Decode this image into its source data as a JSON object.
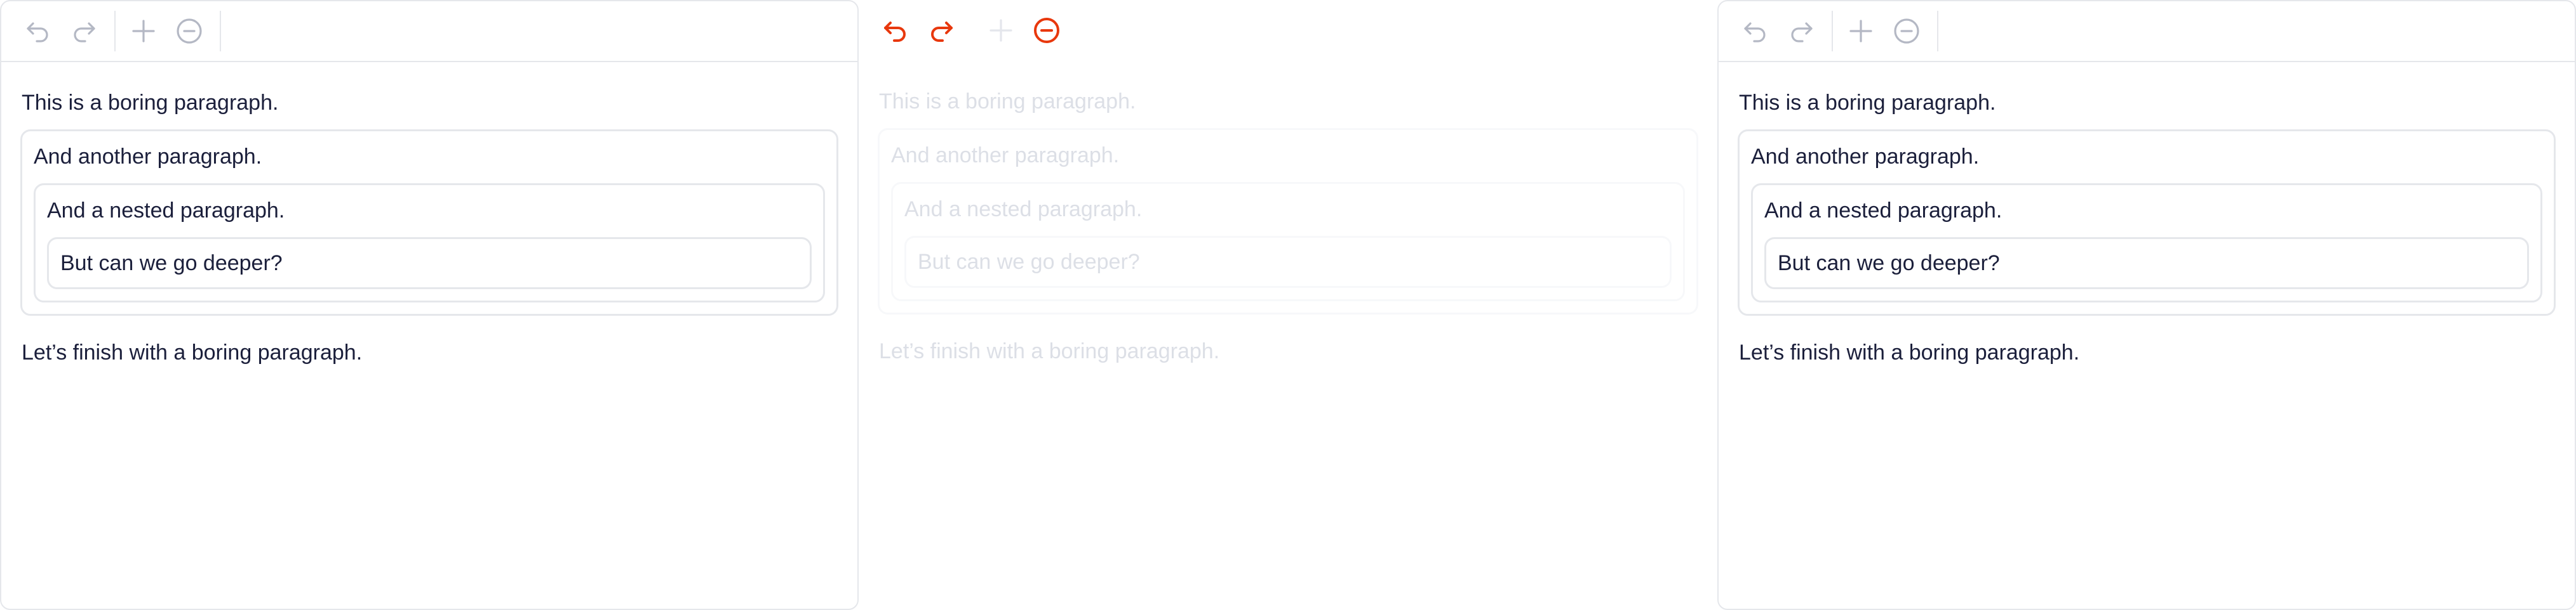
{
  "colors": {
    "text": "#1b1f3b",
    "border": "#e5e7eb",
    "icon_disabled": "#b4b8c4",
    "icon_enabled": "#e8380d",
    "faded_text": "#dcdfe6"
  },
  "icons": [
    "undo-icon",
    "redo-icon",
    "plus-icon",
    "minus-circle-icon"
  ],
  "panes": [
    {
      "state": "normal",
      "paragraphs": {
        "first": "This is a boring paragraph.",
        "second": "And another paragraph.",
        "nested": "And a nested paragraph.",
        "deeper": "But can we go deeper?",
        "last": "Let’s finish with a boring paragraph."
      }
    },
    {
      "state": "faded",
      "paragraphs": {
        "first": "This is a boring paragraph.",
        "second": "And another paragraph.",
        "nested": "And a nested paragraph.",
        "deeper": "But can we go deeper?",
        "last": "Let’s finish with a boring paragraph."
      }
    },
    {
      "state": "normal",
      "paragraphs": {
        "first": "This is a boring paragraph.",
        "second": "And another paragraph.",
        "nested": "And a nested paragraph.",
        "deeper": "But can we go deeper?",
        "last": "Let’s finish with a boring paragraph."
      }
    }
  ]
}
